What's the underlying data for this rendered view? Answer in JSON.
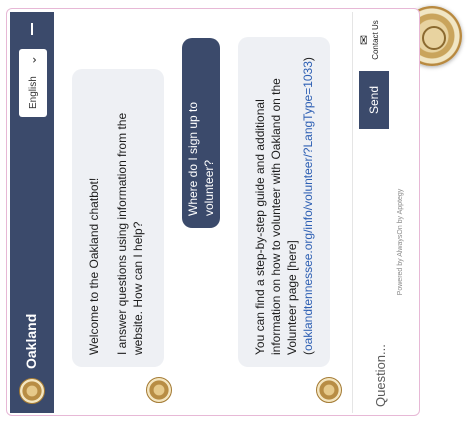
{
  "header": {
    "title": "Oakland",
    "language": "English",
    "chevron": "⌄"
  },
  "messages": {
    "welcome_line1": "Welcome to the Oakland chatbot!",
    "welcome_line2": "I answer questions using information from the website. How can I help?",
    "user_question": "Where do I sign up to volunteer?",
    "answer_text": "You can find a step-by-step guide and additional information on how to volunteer with Oakland on the Volunteer page [here] (",
    "answer_link": "oaklandtennessee.org/info/volunteer/?LangType=1033",
    "answer_end": ")"
  },
  "composer": {
    "placeholder": "Question...",
    "send_label": "Send",
    "contact_label": "Contact Us",
    "powered_by": "Powered by AlwaysOn by Apptegy"
  },
  "icons": {
    "mail": "✉",
    "menu": "menu-icon",
    "seal": "city-seal-icon"
  },
  "colors": {
    "primary": "#3b4a6b",
    "bot_bubble": "#eef0f4",
    "link": "#2d5fb3",
    "frame_border": "#e7b8d6"
  }
}
